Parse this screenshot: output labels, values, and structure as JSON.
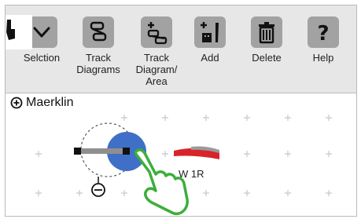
{
  "toolbar": {
    "items": [
      {
        "label": "Selction",
        "icon": "chevron-down-icon"
      },
      {
        "label": "Track\nDiagrams",
        "icon": "track-diagrams-icon"
      },
      {
        "label": "Track\nDiagram/\nArea",
        "icon": "add-track-area-icon"
      },
      {
        "label": "Add",
        "icon": "add-accessory-icon"
      },
      {
        "label": "Delete",
        "icon": "trash-icon"
      },
      {
        "label": "Help",
        "icon": "question-mark-icon"
      }
    ]
  },
  "layout": {
    "title": "Maerklin",
    "expand_icon": "circle-plus-icon"
  },
  "track": {
    "label": "W 1R"
  },
  "colors": {
    "toolbar_bg": "#e7e7e7",
    "button_bg": "#a2a2a2",
    "selection_blue": "#3f6fc6",
    "track_red": "#d8232a",
    "grid_plus": "#c8c8c8",
    "hand_green": "#3cae3a"
  }
}
